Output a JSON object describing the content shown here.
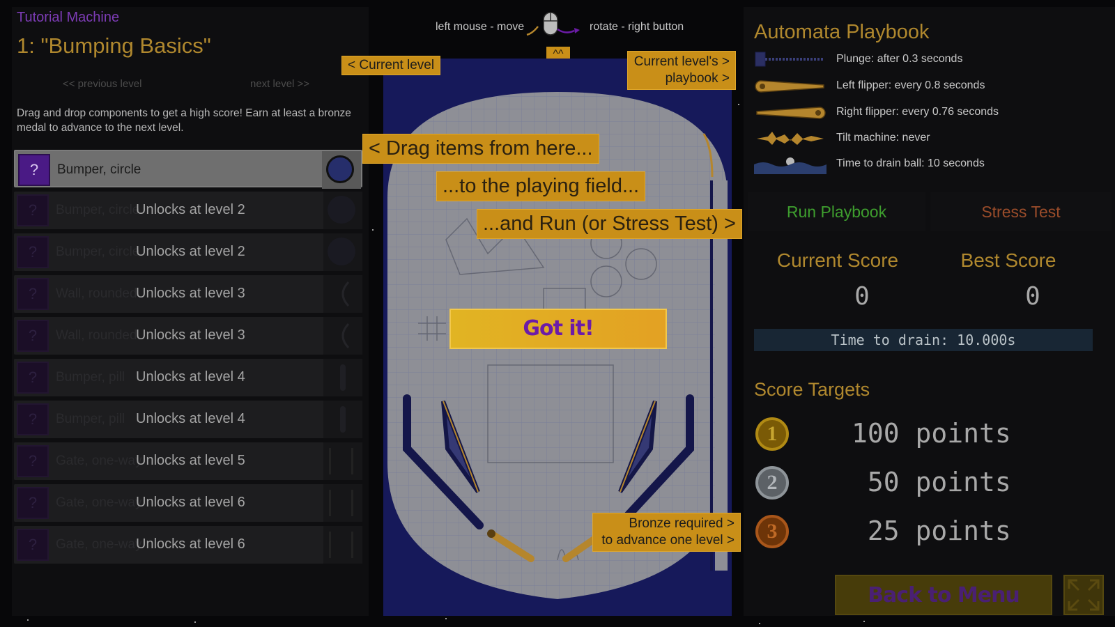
{
  "header": {
    "machine_label": "Tutorial Machine",
    "level_title": "1: \"Bumping Basics\"",
    "previous_level": "<< previous level",
    "next_level": "next level >>",
    "instructions": "Drag and drop components to get a high score! Earn at least a bronze medal to advance to the next level."
  },
  "components": [
    {
      "name": "Bumper, circle",
      "lock": "",
      "icon": "?",
      "preview": "circle-bumper"
    },
    {
      "name": "Bumper, circle",
      "lock": "Unlocks at level 2",
      "icon": "?",
      "preview": "circle-bumper"
    },
    {
      "name": "Bumper, circle",
      "lock": "Unlocks at level 2",
      "icon": "?",
      "preview": "circle-bumper"
    },
    {
      "name": "Wall, rounded",
      "lock": "Unlocks at level 3",
      "icon": "?",
      "preview": "curved-wall"
    },
    {
      "name": "Wall, rounded",
      "lock": "Unlocks at level 3",
      "icon": "?",
      "preview": "curved-wall"
    },
    {
      "name": "Bumper, pill",
      "lock": "Unlocks at level 4",
      "icon": "?",
      "preview": "pill-bumper"
    },
    {
      "name": "Bumper, pill",
      "lock": "Unlocks at level 4",
      "icon": "?",
      "preview": "pill-bumper"
    },
    {
      "name": "Gate, one-way",
      "lock": "Unlocks at level 5",
      "icon": "?",
      "preview": "gate"
    },
    {
      "name": "Gate, one-way",
      "lock": "Unlocks at level 6",
      "icon": "?",
      "preview": "gate"
    },
    {
      "name": "Gate, one-way",
      "lock": "Unlocks at level 6",
      "icon": "?",
      "preview": "gate"
    }
  ],
  "mouse_hint": {
    "left": "left mouse - move",
    "right": "rotate - right button",
    "caret": "^^"
  },
  "tutorial": {
    "current_level": "< Current level",
    "playbook_line1": "Current level's >",
    "playbook_line2": "playbook >",
    "drag_items": "< Drag items from here...",
    "to_field": "...to the playing field...",
    "run": "...and Run (or Stress Test) >",
    "got_it": "Got it!",
    "bronze_line1": "Bronze required >",
    "bronze_line2": "to advance one level >"
  },
  "playbook": {
    "title": "Automata Playbook",
    "rows": [
      {
        "icon": "plunger-icon",
        "text": "Plunge: after 0.3 seconds"
      },
      {
        "icon": "left-flipper-icon",
        "text": "Left flipper: every 0.8 seconds"
      },
      {
        "icon": "right-flipper-icon",
        "text": "Right flipper: every 0.76 seconds"
      },
      {
        "icon": "tilt-icon",
        "text": "Tilt machine: never"
      },
      {
        "icon": "drain-icon",
        "text": "Time to drain ball: 10 seconds"
      }
    ],
    "run_label": "Run Playbook",
    "stress_label": "Stress Test"
  },
  "scores": {
    "current_label": "Current Score",
    "best_label": "Best Score",
    "current_value": "0",
    "best_value": "0",
    "drain_text": "Time to drain: 10.000s"
  },
  "targets": {
    "title": "Score Targets",
    "items": [
      {
        "medal": "1",
        "points": "100 points",
        "color": "#b08a14"
      },
      {
        "medal": "2",
        "points": " 50 points",
        "color": "#8e9499"
      },
      {
        "medal": "3",
        "points": " 25 points",
        "color": "#a9561a"
      }
    ]
  },
  "footer": {
    "back_label": "Back to Menu"
  },
  "colors": {
    "accent_gold": "#b0882e",
    "accent_purple": "#6c1ca8",
    "tutorial_label": "#c98f18",
    "playfield_navy": "#16195a"
  }
}
